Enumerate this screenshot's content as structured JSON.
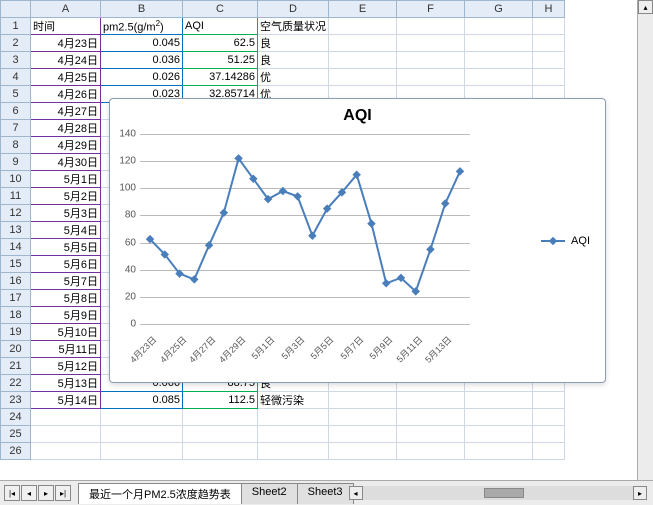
{
  "columns": [
    "",
    "A",
    "B",
    "C",
    "D",
    "E",
    "F",
    "G",
    "H"
  ],
  "headers": {
    "A": "时间",
    "B": "pm2.5(g/m",
    "Bsup": "2",
    "Bclose": ")",
    "C": "AQI",
    "D": "空气质量状况"
  },
  "rows": [
    {
      "n": "1"
    },
    {
      "n": "2",
      "A": "4月23日",
      "B": "0.045",
      "C": "62.5",
      "D": "良"
    },
    {
      "n": "3",
      "A": "4月24日",
      "B": "0.036",
      "C": "51.25",
      "D": "良"
    },
    {
      "n": "4",
      "A": "4月25日",
      "B": "0.026",
      "C": "37.14286",
      "D": "优"
    },
    {
      "n": "5",
      "A": "4月26日",
      "B": "0.023",
      "C": "32.85714",
      "D": "优"
    },
    {
      "n": "6",
      "A": "4月27日",
      "B": "",
      "C": "",
      "D": ""
    },
    {
      "n": "7",
      "A": "4月28日",
      "B": "",
      "C": "",
      "D": ""
    },
    {
      "n": "8",
      "A": "4月29日",
      "B": "",
      "C": "",
      "D": ""
    },
    {
      "n": "9",
      "A": "4月30日",
      "B": "",
      "C": "",
      "D": ""
    },
    {
      "n": "10",
      "A": "5月1日",
      "B": "",
      "C": "",
      "D": ""
    },
    {
      "n": "11",
      "A": "5月2日",
      "B": "",
      "C": "",
      "D": ""
    },
    {
      "n": "12",
      "A": "5月3日",
      "B": "",
      "C": "",
      "D": ""
    },
    {
      "n": "13",
      "A": "5月4日",
      "B": "",
      "C": "",
      "D": ""
    },
    {
      "n": "14",
      "A": "5月5日",
      "B": "",
      "C": "",
      "D": ""
    },
    {
      "n": "15",
      "A": "5月6日",
      "B": "",
      "C": "",
      "D": ""
    },
    {
      "n": "16",
      "A": "5月7日",
      "B": "",
      "C": "",
      "D": ""
    },
    {
      "n": "17",
      "A": "5月8日",
      "B": "",
      "C": "",
      "D": ""
    },
    {
      "n": "18",
      "A": "5月9日",
      "B": "",
      "C": "",
      "D": ""
    },
    {
      "n": "19",
      "A": "5月10日",
      "B": "",
      "C": "",
      "D": ""
    },
    {
      "n": "20",
      "A": "5月11日",
      "B": "",
      "C": "",
      "D": ""
    },
    {
      "n": "21",
      "A": "5月12日",
      "B": "",
      "C": "",
      "D": ""
    },
    {
      "n": "22",
      "A": "5月13日",
      "B": "0.066",
      "C": "88.75",
      "D": "良"
    },
    {
      "n": "23",
      "A": "5月14日",
      "B": "0.085",
      "C": "112.5",
      "D": "轻微污染"
    },
    {
      "n": "24"
    },
    {
      "n": "25"
    },
    {
      "n": "26"
    }
  ],
  "sheets": {
    "active": "最近一个月PM2.5浓度趋势表",
    "others": [
      "Sheet2",
      "Sheet3"
    ]
  },
  "nav": {
    "first": "|◂",
    "prev": "◂",
    "next": "▸",
    "last": "▸|"
  },
  "chart_data": {
    "type": "line",
    "title": "AQI",
    "xlabel": "",
    "ylabel": "",
    "ylim": [
      0,
      140
    ],
    "yticks": [
      0,
      20,
      40,
      60,
      80,
      100,
      120,
      140
    ],
    "categories": [
      "4月23日",
      "4月25日",
      "4月27日",
      "4月29日",
      "5月1日",
      "5月3日",
      "5月5日",
      "5月7日",
      "5月9日",
      "5月11日",
      "5月13日"
    ],
    "series": [
      {
        "name": "AQI",
        "x": [
          "4月23日",
          "4月24日",
          "4月25日",
          "4月26日",
          "4月27日",
          "4月28日",
          "4月29日",
          "4月30日",
          "5月1日",
          "5月2日",
          "5月3日",
          "5月4日",
          "5月5日",
          "5月6日",
          "5月7日",
          "5月8日",
          "5月9日",
          "5月10日",
          "5月11日",
          "5月12日",
          "5月13日",
          "5月14日"
        ],
        "values": [
          62.5,
          51.25,
          37.14,
          32.86,
          58,
          82,
          122,
          107,
          92,
          98,
          94,
          65,
          85,
          97,
          110,
          74,
          30,
          34,
          24,
          55,
          88.75,
          112.5
        ]
      }
    ]
  }
}
